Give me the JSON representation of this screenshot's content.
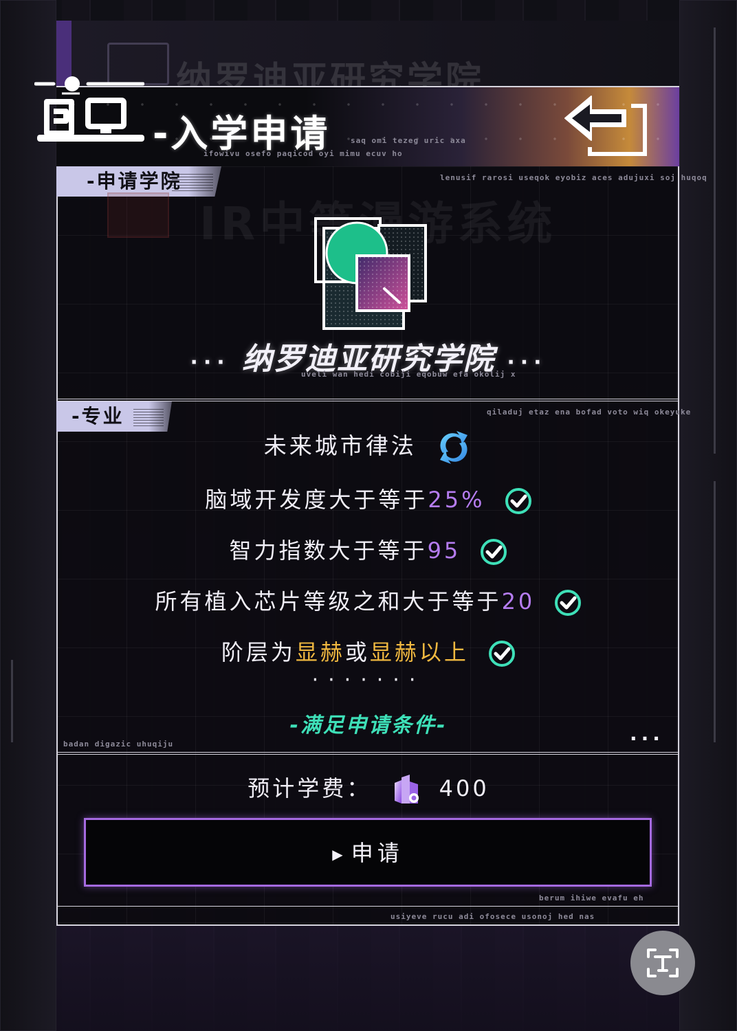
{
  "header": {
    "ghost_title": "纳罗迪亚研究学院",
    "title": "-入学申请",
    "caption_1": "saq omi tezeg uric axa",
    "caption_2": "ifowivu osefo paqicod oyi mimu ecuv ho"
  },
  "academy_section": {
    "tab_label": "-申请学院",
    "caption": "lenusif rarosi useqok eyobiz aces adujuxi soj huqoq",
    "ghost_system_text": "IR中等漫游系统",
    "academy_name": "纳罗迪亚研究学院",
    "name_dots": "···",
    "academy_caption": "uveli wan hedi cobiji eqobuw efa okolij x"
  },
  "major_section": {
    "tab_label": "-专业",
    "caption": "qiladuj etaz ena bofad voto wiq okeyuke",
    "major_name": "未来城市律法",
    "requirements": [
      {
        "prefix": "脑域开发度大于等于",
        "value": "25%"
      },
      {
        "prefix": "智力指数大于等于",
        "value": "95"
      },
      {
        "prefix": "所有植入芯片等级之和大于等于",
        "value": "20"
      }
    ],
    "class_requirement": {
      "prefix": "阶层为",
      "class_1": "显赫",
      "joiner": "或",
      "class_2": "显赫以上"
    },
    "separator": "·······",
    "status": "-满足申请条件-",
    "footer_caption": "badan digazic uhuqiju",
    "corner_dots": "···"
  },
  "fee": {
    "label": "预计学费：",
    "amount": "400",
    "currency_icon": "crystal-currency-icon"
  },
  "apply_button": {
    "label": "申请",
    "caption": "berum ihiwe evafu eh"
  },
  "bottom_caption": "usiyeve rucu adi ofosece usonoj hed nas",
  "colors": {
    "accent_purple": "#b57cf0",
    "accent_gold": "#f0b840",
    "accent_teal": "#3ee0b8",
    "button_border": "#a56ae0"
  }
}
